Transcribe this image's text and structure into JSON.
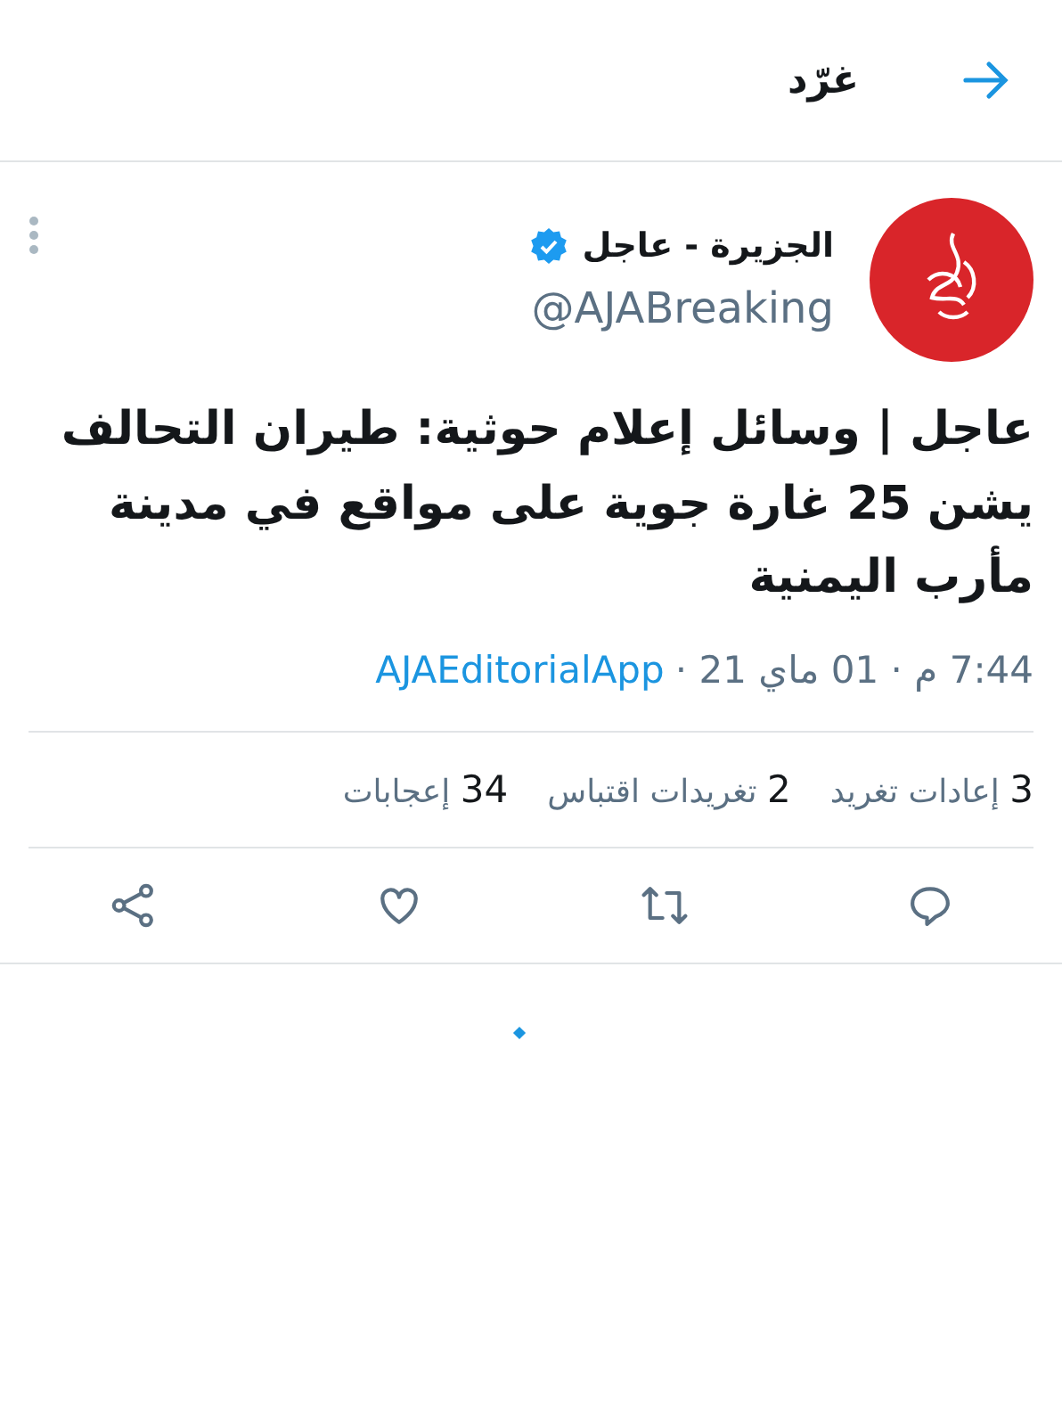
{
  "header": {
    "title": "غرّد"
  },
  "tweet": {
    "author": {
      "name": "الجزيرة - عاجل",
      "handle": "@AJABreaking",
      "verified": true
    },
    "text": "عاجل | وسائل إعلام حوثية: طيران التحالف يشن 25 غارة جوية على مواقع في مدينة مأرب اليمنية",
    "time": "7:44 م · 01 ماي 21 ·",
    "source": "AJAEditorialApp",
    "stats": [
      {
        "count": "3",
        "label": "إعادات تغريد"
      },
      {
        "count": "2",
        "label": "تغريدات اقتباس"
      },
      {
        "count": "34",
        "label": "إعجابات"
      }
    ],
    "actions": [
      {
        "kind": "reply"
      },
      {
        "kind": "retweet"
      },
      {
        "kind": "like"
      },
      {
        "kind": "share"
      }
    ]
  },
  "loading": true
}
